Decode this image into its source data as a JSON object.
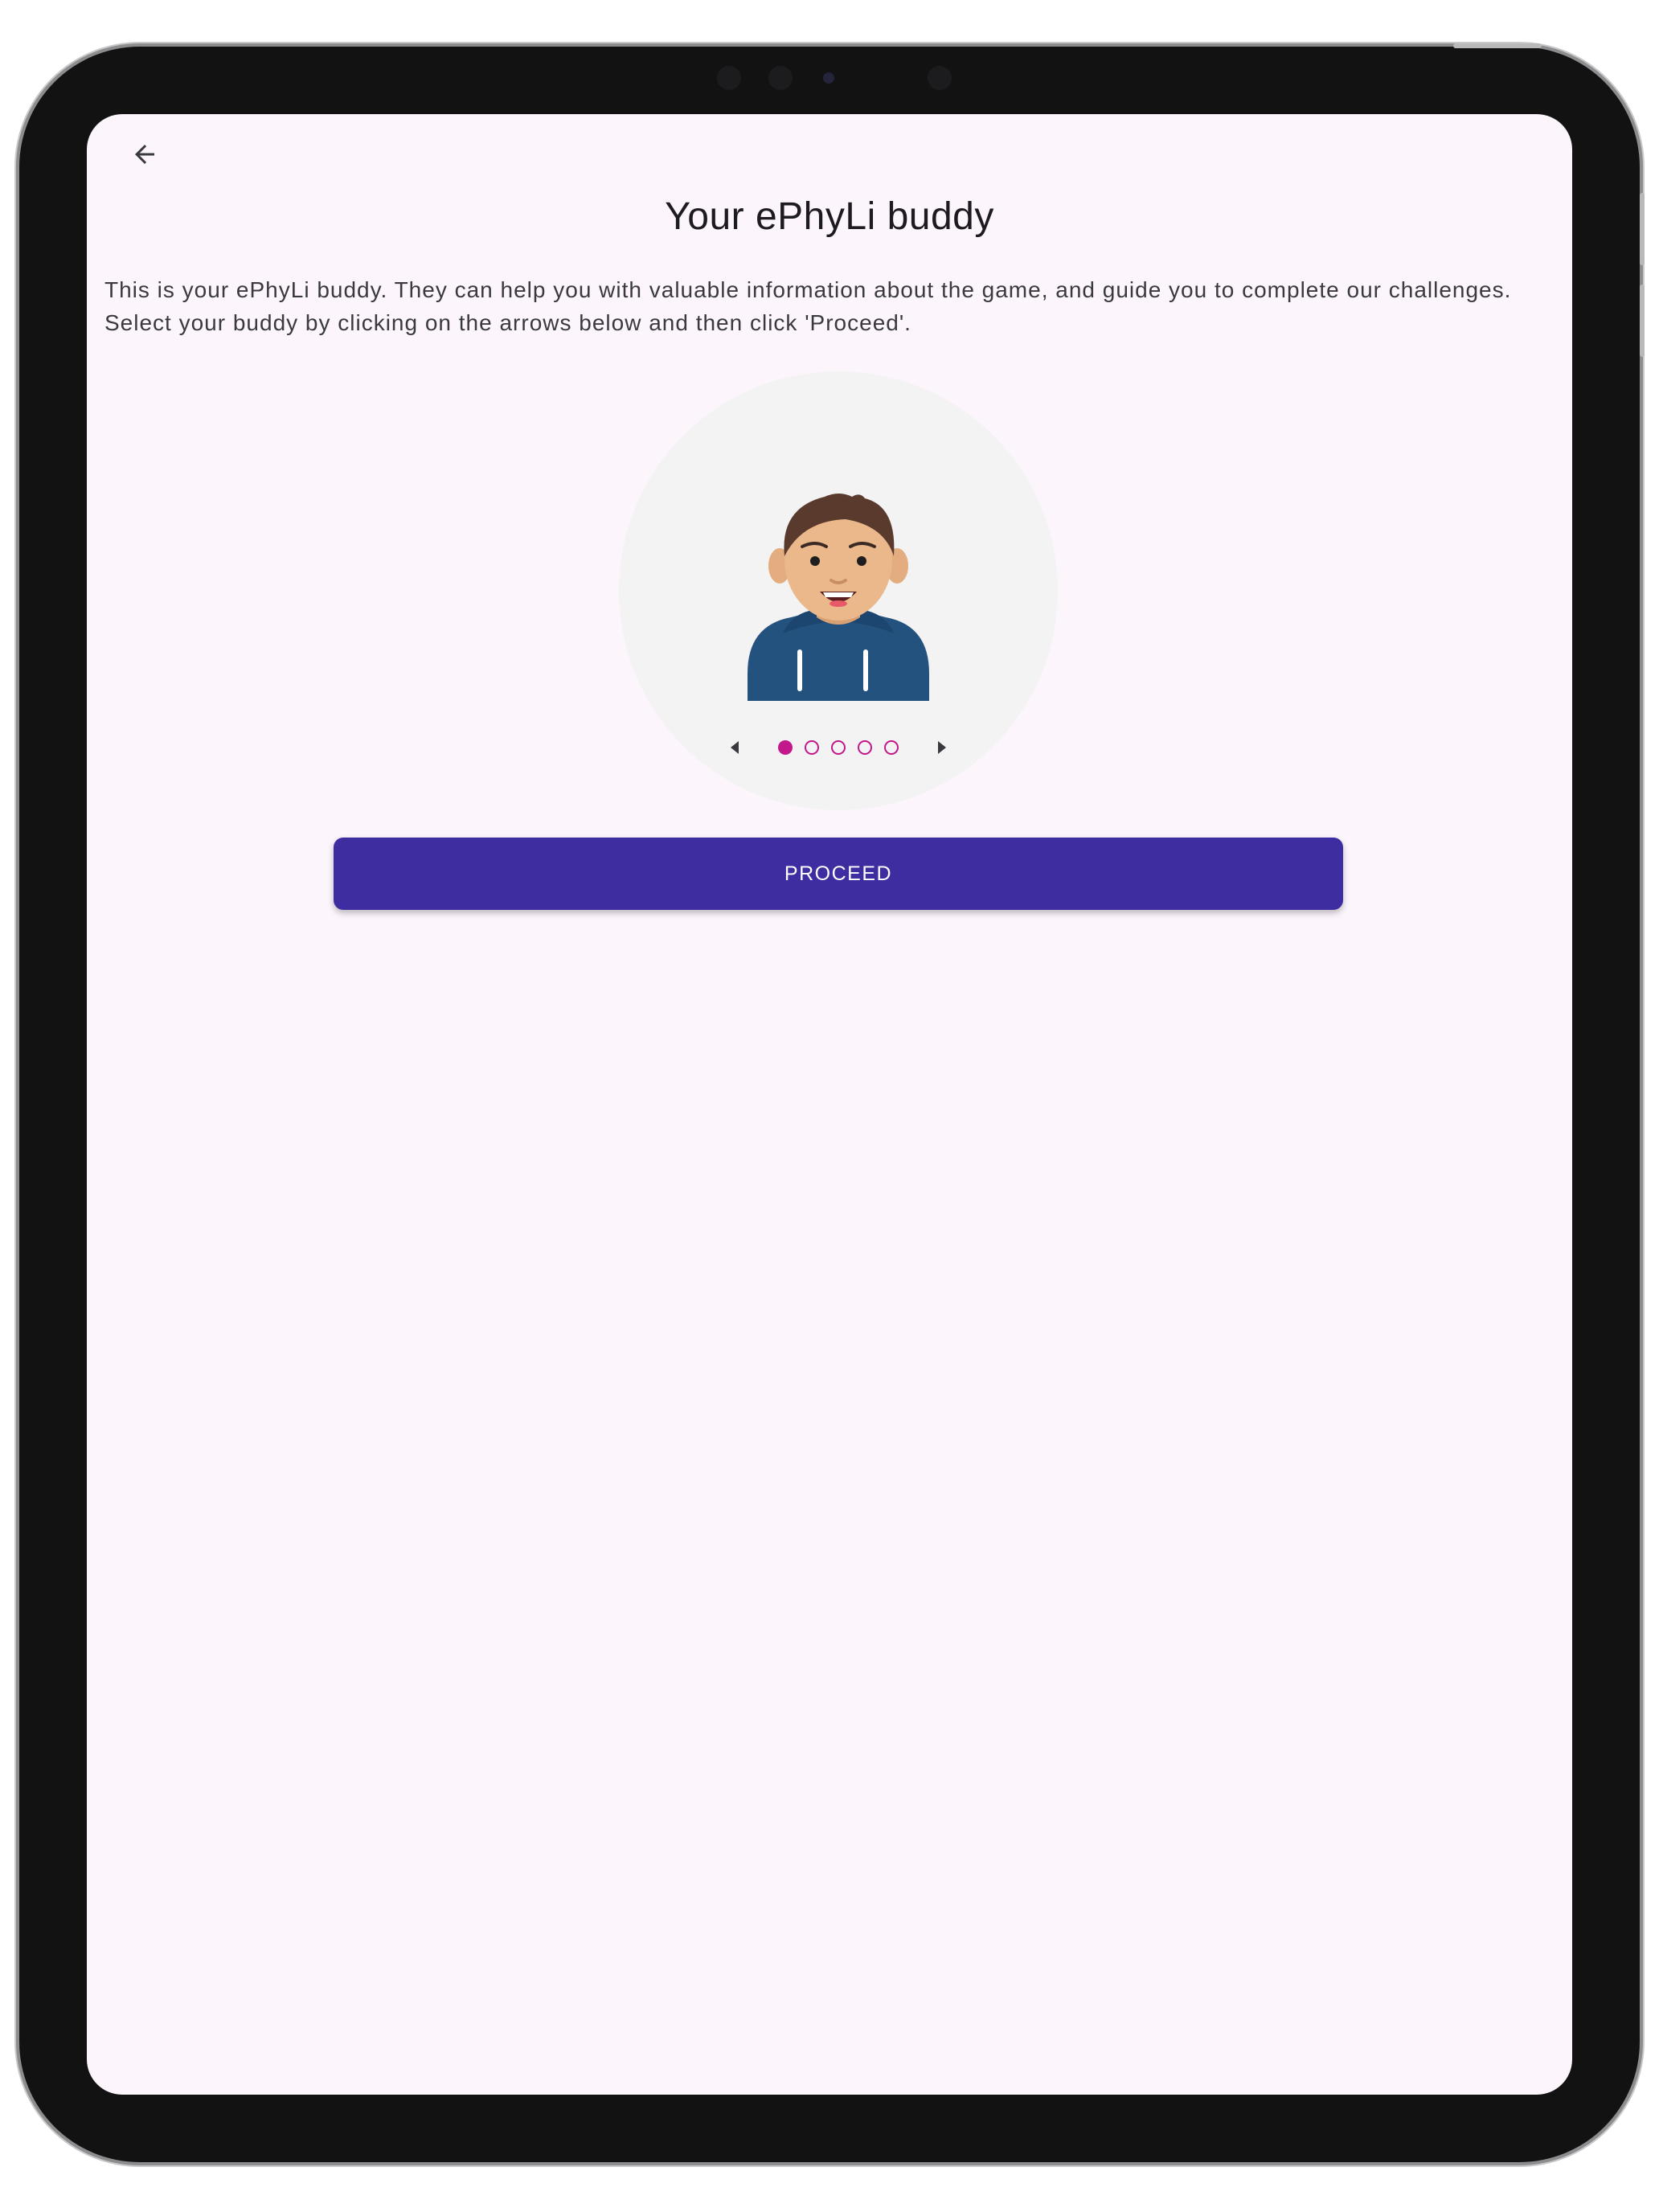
{
  "app": {
    "title": "Your ePhyLi buddy",
    "intro": "This is your ePhyLi buddy. They can help you with valuable information about the game, and guide you to complete our challenges. Select your buddy by clicking on the arrows below and then click 'Proceed'."
  },
  "navigation": {
    "back_icon": "arrow-left-icon"
  },
  "buddy_selector": {
    "avatar_icon": "boy-avatar-blue-hoodie",
    "prev_icon": "caret-left-icon",
    "next_icon": "caret-right-icon",
    "total_options": 5,
    "selected_index": 0
  },
  "actions": {
    "proceed_label": "PROCEED"
  },
  "colors": {
    "screen_background": "#fcf5fc",
    "primary_button": "#3e2ca1",
    "indicator_accent": "#c2188c",
    "circle_background": "#f3f3f3",
    "hoodie": "#24527e"
  }
}
